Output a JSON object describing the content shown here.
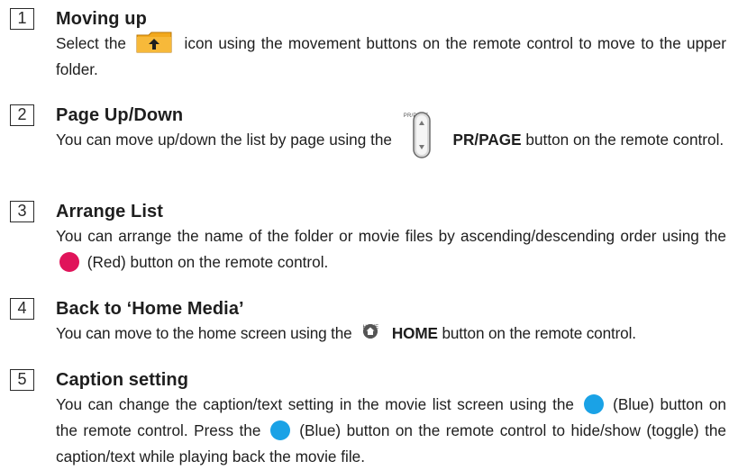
{
  "sections": [
    {
      "number": "1",
      "title": "Moving up",
      "text_before_icon": "Select the",
      "icon": "folder-up-icon",
      "text_after_icon": "icon using the movement buttons on the remote control to move to the upper folder."
    },
    {
      "number": "2",
      "title": "Page Up/Down",
      "text_before_icon": "You can move up/down the list by page using the",
      "icon": "pr-page-button-icon",
      "icon_caption": "PR/PAGE",
      "button_label": "PR/PAGE",
      "text_after_icon": "button on the remote control."
    },
    {
      "number": "3",
      "title": "Arrange List",
      "text_before_icon": "You can arrange the name of the folder or movie files by ascending/descending order using the",
      "icon": "red-button-icon",
      "text_after_icon": "(Red) button on the remote control."
    },
    {
      "number": "4",
      "title": "Back to ‘Home Media’",
      "text_before_icon": "You can move to the home screen using the",
      "icon": "home-button-icon",
      "icon_caption": "HOME",
      "button_label": "HOME",
      "text_after_icon": "button on the remote control."
    },
    {
      "number": "5",
      "title": "Caption setting",
      "text_part1": "You can change the caption/text setting in the movie list screen using the",
      "icon": "blue-button-icon",
      "text_part2": "(Blue) button on the remote control. Press the",
      "text_part3": "(Blue) button on the remote control to hide/show (toggle) the caption/text while playing back the movie file."
    }
  ],
  "colors": {
    "red_button": "#e0145a",
    "blue_button": "#1aa2e6",
    "folder_icon": "#f2a81c"
  }
}
